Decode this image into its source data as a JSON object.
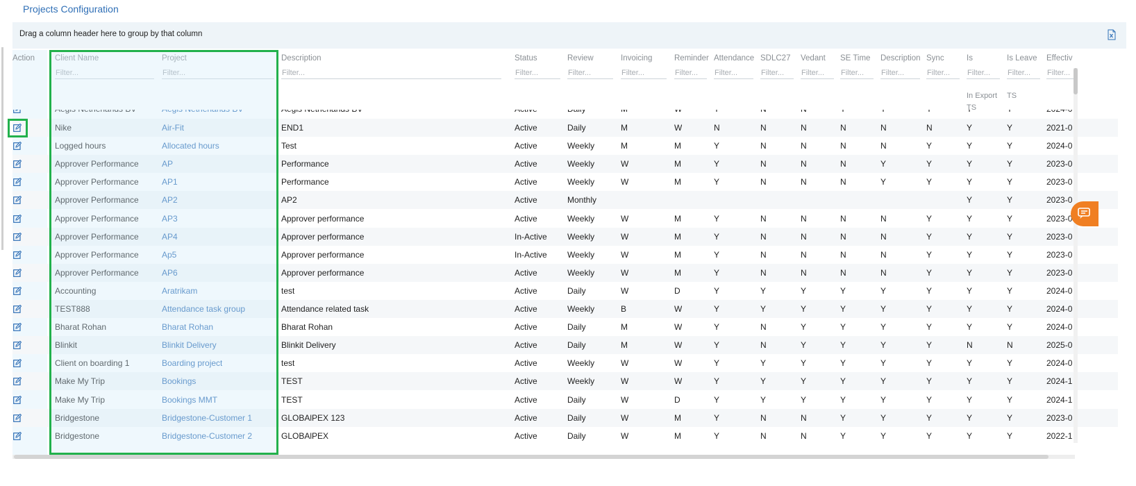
{
  "page_title": "Projects Configuration",
  "group_bar_text": "Drag a column header here to group by that column",
  "filter_placeholder": "Filter...",
  "columns": [
    {
      "label": "Action",
      "sub": ""
    },
    {
      "label": "Client Name",
      "sub": ""
    },
    {
      "label": "Project",
      "sub": ""
    },
    {
      "label": "Description",
      "sub": ""
    },
    {
      "label": "Status",
      "sub": ""
    },
    {
      "label": "Review",
      "sub": ""
    },
    {
      "label": "Invoicing",
      "sub": ""
    },
    {
      "label": "Reminder",
      "sub": ""
    },
    {
      "label": "Attendance",
      "sub": ""
    },
    {
      "label": "SDLC27",
      "sub": ""
    },
    {
      "label": "Vedant",
      "sub": ""
    },
    {
      "label": "SE Time",
      "sub": ""
    },
    {
      "label": "Description",
      "sub": ""
    },
    {
      "label": "Sync",
      "sub": ""
    },
    {
      "label": "Is",
      "sub": "In Export\nTS"
    },
    {
      "label": "Is Leave",
      "sub": "TS"
    },
    {
      "label": "Effectiv",
      "sub": ""
    }
  ],
  "partial_row": [
    "Aegis Netherlands BV",
    "Aegis Netherlands BV",
    "Aegis Netherlands BV",
    "Active",
    "Daily",
    "M",
    "W",
    "Y",
    "N",
    "N",
    "Y",
    "Y",
    "Y",
    "Y",
    "Y",
    "2024-0"
  ],
  "rows": [
    [
      "Nike",
      "Air-Fit",
      "END1",
      "Active",
      "Daily",
      "M",
      "W",
      "N",
      "N",
      "N",
      "N",
      "N",
      "N",
      "Y",
      "Y",
      "2021-0"
    ],
    [
      "Logged hours",
      "Allocated hours",
      "Test",
      "Active",
      "Weekly",
      "M",
      "M",
      "Y",
      "N",
      "N",
      "N",
      "N",
      "Y",
      "Y",
      "Y",
      "2024-0"
    ],
    [
      "Approver Performance",
      "AP",
      "Performance",
      "Active",
      "Weekly",
      "W",
      "M",
      "Y",
      "N",
      "N",
      "N",
      "Y",
      "Y",
      "Y",
      "Y",
      "2023-0"
    ],
    [
      "Approver Performance",
      "AP1",
      "Performance",
      "Active",
      "Weekly",
      "W",
      "M",
      "Y",
      "N",
      "N",
      "N",
      "Y",
      "Y",
      "Y",
      "Y",
      "2023-0"
    ],
    [
      "Approver Performance",
      "AP2",
      "AP2",
      "Active",
      "Monthly",
      "",
      "",
      "",
      "",
      "",
      "",
      "",
      "",
      "Y",
      "Y",
      "2023-0"
    ],
    [
      "Approver Performance",
      "AP3",
      "Approver performance",
      "Active",
      "Weekly",
      "W",
      "M",
      "Y",
      "N",
      "N",
      "N",
      "N",
      "Y",
      "Y",
      "Y",
      "2023-0"
    ],
    [
      "Approver Performance",
      "AP4",
      "Approver performance",
      "In-Active",
      "Weekly",
      "W",
      "M",
      "Y",
      "N",
      "N",
      "N",
      "N",
      "Y",
      "Y",
      "Y",
      "2023-0"
    ],
    [
      "Approver Performance",
      "Ap5",
      "Approver performance",
      "In-Active",
      "Weekly",
      "W",
      "M",
      "Y",
      "N",
      "N",
      "N",
      "N",
      "Y",
      "Y",
      "Y",
      "2023-0"
    ],
    [
      "Approver Performance",
      "AP6",
      "Approver performance",
      "Active",
      "Weekly",
      "W",
      "M",
      "Y",
      "N",
      "N",
      "N",
      "N",
      "Y",
      "Y",
      "Y",
      "2023-0"
    ],
    [
      "Accounting",
      "Aratrikam",
      "test",
      "Active",
      "Daily",
      "W",
      "D",
      "Y",
      "Y",
      "Y",
      "Y",
      "Y",
      "Y",
      "Y",
      "Y",
      "2024-0"
    ],
    [
      "TEST888",
      "Attendance task group",
      "Attendance related task",
      "Active",
      "Weekly",
      "B",
      "W",
      "Y",
      "Y",
      "Y",
      "Y",
      "Y",
      "Y",
      "Y",
      "Y",
      "2024-0"
    ],
    [
      "Bharat Rohan",
      "Bharat Rohan",
      "Bharat Rohan",
      "Active",
      "Daily",
      "M",
      "W",
      "Y",
      "N",
      "Y",
      "Y",
      "Y",
      "Y",
      "Y",
      "Y",
      "2024-0"
    ],
    [
      "Blinkit",
      "Blinkit Delivery",
      "Blinkit Delivery",
      "Active",
      "Daily",
      "M",
      "W",
      "Y",
      "N",
      "Y",
      "Y",
      "Y",
      "Y",
      "N",
      "N",
      "2025-0"
    ],
    [
      "Client on boarding 1",
      "Boarding project",
      "test",
      "Active",
      "Weekly",
      "W",
      "W",
      "Y",
      "Y",
      "Y",
      "Y",
      "Y",
      "Y",
      "Y",
      "Y",
      "2024-0"
    ],
    [
      "Make My Trip",
      "Bookings",
      "TEST",
      "Active",
      "Weekly",
      "W",
      "W",
      "Y",
      "Y",
      "Y",
      "Y",
      "Y",
      "Y",
      "Y",
      "Y",
      "2024-1"
    ],
    [
      "Make My Trip",
      "Bookings MMT",
      "TEST",
      "Active",
      "Daily",
      "W",
      "D",
      "Y",
      "Y",
      "Y",
      "Y",
      "Y",
      "Y",
      "Y",
      "Y",
      "2024-1"
    ],
    [
      "Bridgestone",
      "Bridgestone-Customer 1",
      "GLOBAlPEX 123",
      "Active",
      "Daily",
      "W",
      "M",
      "Y",
      "N",
      "N",
      "Y",
      "Y",
      "Y",
      "Y",
      "Y",
      "2023-0"
    ],
    [
      "Bridgestone",
      "Bridgestone-Customer 2",
      "GLOBAlPEX",
      "Active",
      "Daily",
      "W",
      "M",
      "Y",
      "N",
      "N",
      "Y",
      "Y",
      "Y",
      "Y",
      "Y",
      "2022-1"
    ]
  ]
}
